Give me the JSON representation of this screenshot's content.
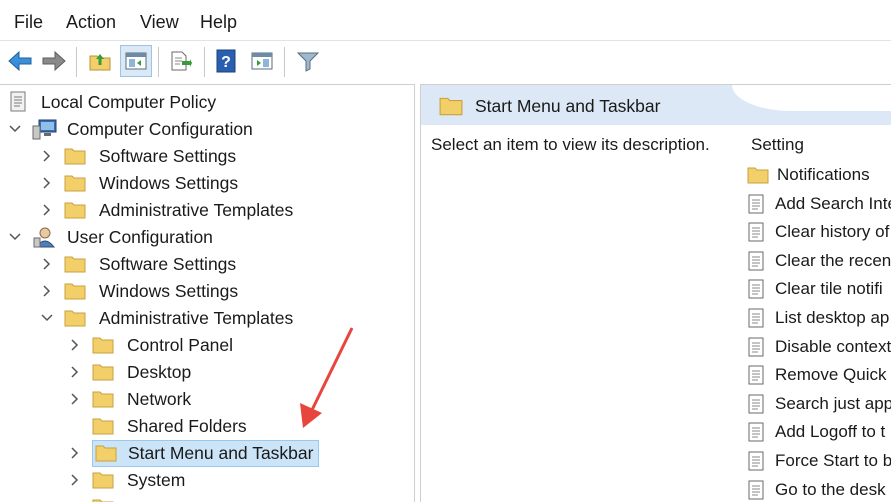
{
  "menu": [
    "File",
    "Action",
    "View",
    "Help"
  ],
  "toolbar": {
    "buttons": [
      "back-icon",
      "forward-icon",
      "up-folder-icon",
      "show-hide-tree-icon",
      "export-list-icon",
      "help-icon",
      "properties-pane-icon",
      "filter-icon"
    ]
  },
  "tree": {
    "root": "Local Computer Policy",
    "computer_config": "Computer Configuration",
    "user_config": "User Configuration",
    "software_settings": "Software Settings",
    "windows_settings": "Windows Settings",
    "admin_templates": "Administrative Templates",
    "control_panel": "Control Panel",
    "desktop": "Desktop",
    "network": "Network",
    "shared_folders": "Shared Folders",
    "start_menu": "Start Menu and Taskbar",
    "system": "System"
  },
  "right": {
    "title": "Start Menu and Taskbar",
    "description": "Select an item to view its description.",
    "column": "Setting",
    "items": [
      {
        "label": "Notifications",
        "type": "folder"
      },
      {
        "label": "Add Search Inte",
        "type": "policy"
      },
      {
        "label": "Clear history of",
        "type": "policy"
      },
      {
        "label": "Clear the recen",
        "type": "policy"
      },
      {
        "label": "Clear tile notifi",
        "type": "policy"
      },
      {
        "label": "List desktop ap",
        "type": "policy"
      },
      {
        "label": "Disable context",
        "type": "policy"
      },
      {
        "label": "Remove Quick",
        "type": "policy"
      },
      {
        "label": "Search just app",
        "type": "policy"
      },
      {
        "label": "Add Logoff to t",
        "type": "policy"
      },
      {
        "label": "Force Start to b",
        "type": "policy"
      },
      {
        "label": "Go to the desk",
        "type": "policy"
      }
    ]
  },
  "colors": {
    "selection_bg": "#cce4f7",
    "header_bg": "#dce8f6",
    "folder": "#f3cf6a",
    "arrow": "#e8453c"
  }
}
